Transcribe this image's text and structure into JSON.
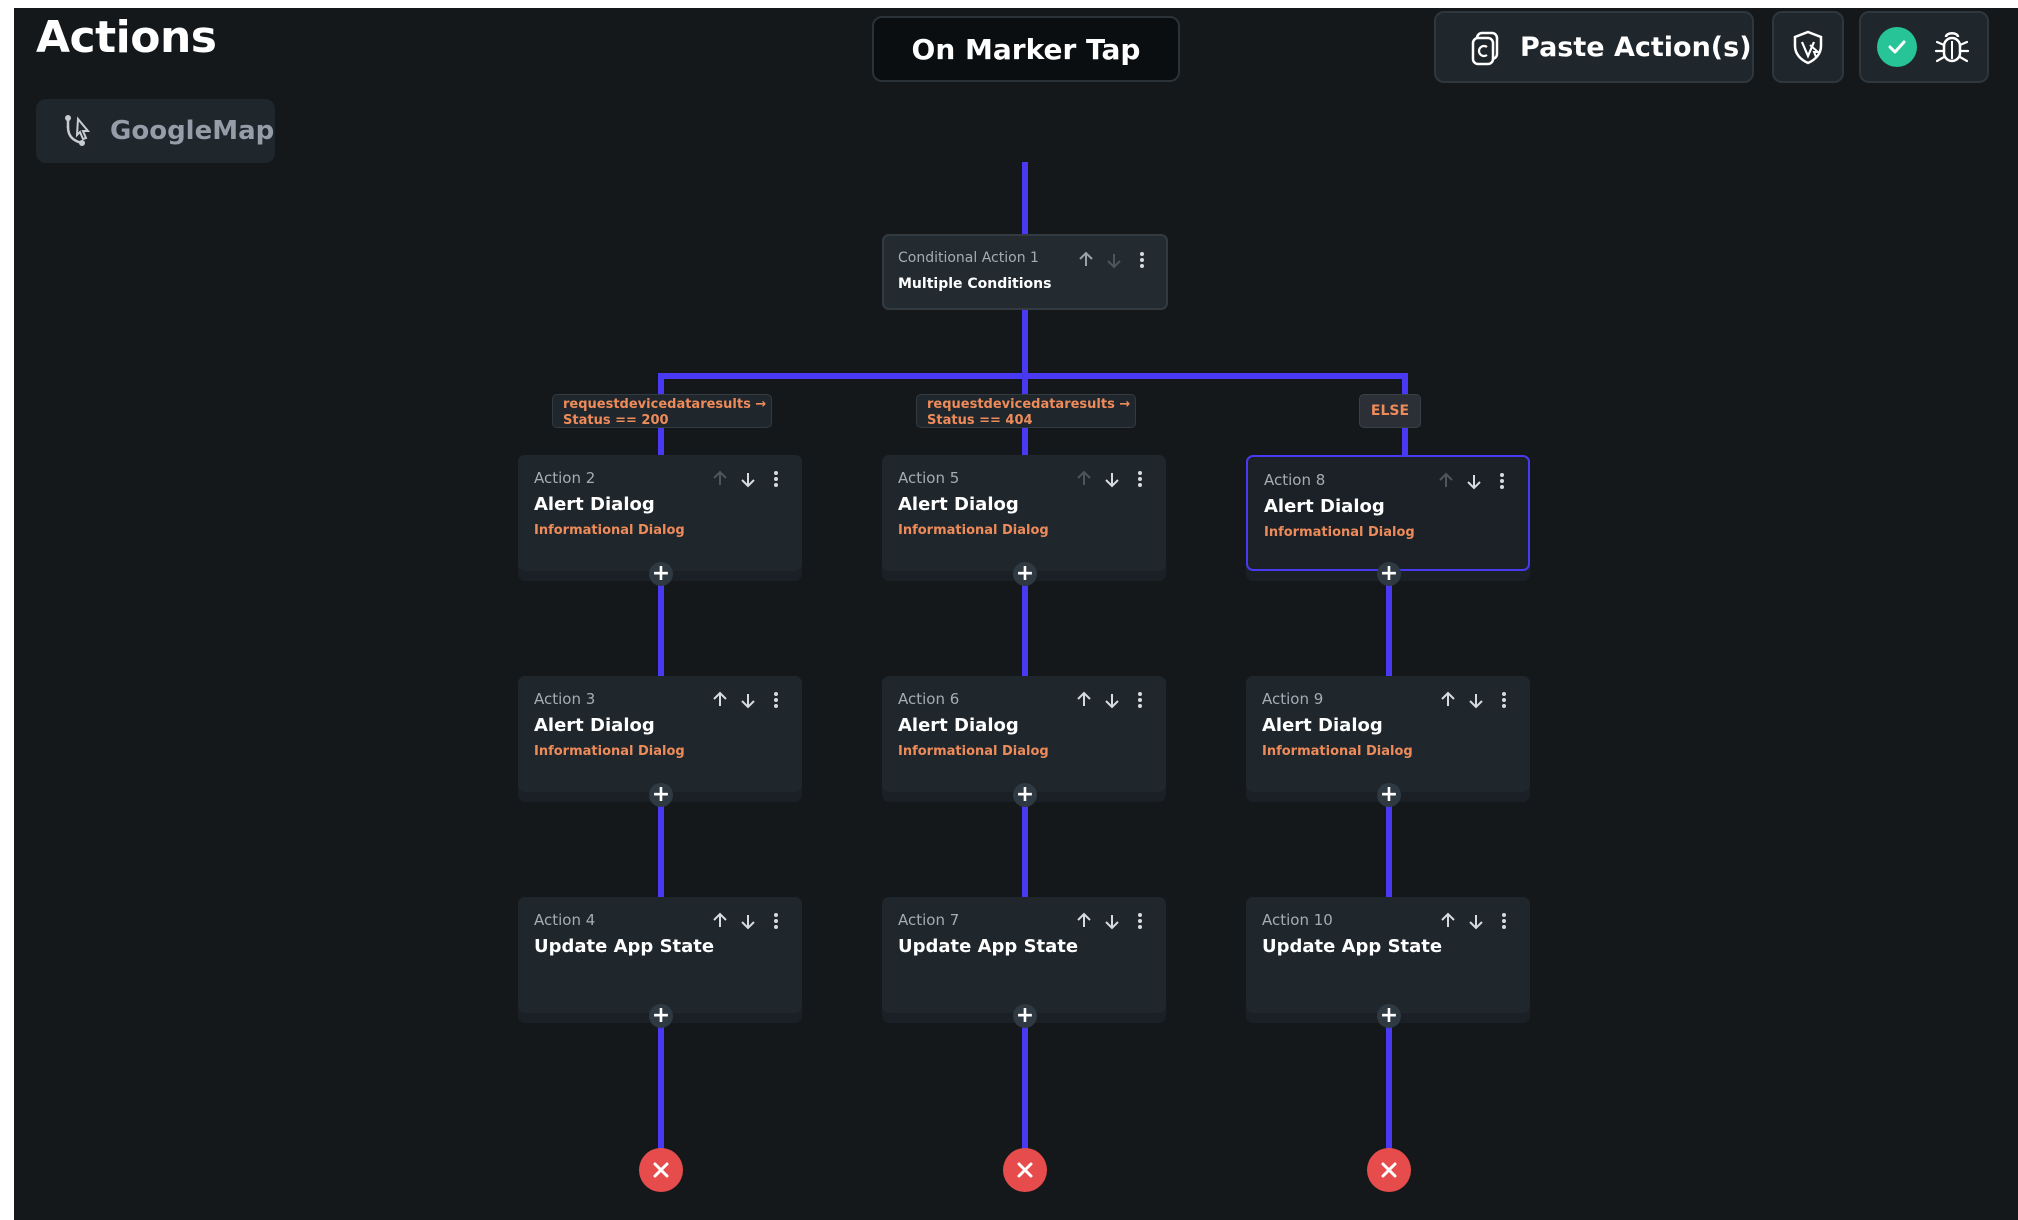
{
  "page": {
    "title": "Actions",
    "widget_name": "GoogleMap",
    "trigger_label": "On Marker Tap"
  },
  "toolbar": {
    "paste_label": "Paste Action(s)"
  },
  "conditional": {
    "label": "Conditional Action 1",
    "title": "Multiple Conditions"
  },
  "branches": [
    {
      "condition": [
        "requestdevicedataresults →",
        "Status == 200"
      ],
      "actions": [
        {
          "label": "Action 2",
          "title": "Alert Dialog",
          "subtitle": "Informational Dialog"
        },
        {
          "label": "Action 3",
          "title": "Alert Dialog",
          "subtitle": "Informational Dialog"
        },
        {
          "label": "Action 4",
          "title": "Update App State",
          "subtitle": ""
        }
      ]
    },
    {
      "condition": [
        "requestdevicedataresults →",
        "Status == 404"
      ],
      "actions": [
        {
          "label": "Action 5",
          "title": "Alert Dialog",
          "subtitle": "Informational Dialog"
        },
        {
          "label": "Action 6",
          "title": "Alert Dialog",
          "subtitle": "Informational Dialog"
        },
        {
          "label": "Action 7",
          "title": "Update App State",
          "subtitle": ""
        }
      ]
    },
    {
      "condition": [
        "ELSE"
      ],
      "actions": [
        {
          "label": "Action 8",
          "title": "Alert Dialog",
          "subtitle": "Informational Dialog"
        },
        {
          "label": "Action 9",
          "title": "Alert Dialog",
          "subtitle": "Informational Dialog"
        },
        {
          "label": "Action 10",
          "title": "Update App State",
          "subtitle": ""
        }
      ]
    }
  ],
  "colors": {
    "background": "#14181b",
    "connector": "#4a39f2",
    "accent_text": "#ed8b5a",
    "end_node": "#e74c4c",
    "status_ok": "#26c496"
  },
  "icons": {
    "widget": "tap-gesture-icon",
    "paste": "paste-icon",
    "shield": "shield-icon",
    "status": "check-circle-icon",
    "debug": "bug-icon",
    "node_controls": [
      "arrow-up-icon",
      "arrow-down-icon",
      "more-vert-icon"
    ],
    "add": "plus-icon",
    "end": "close-icon"
  }
}
